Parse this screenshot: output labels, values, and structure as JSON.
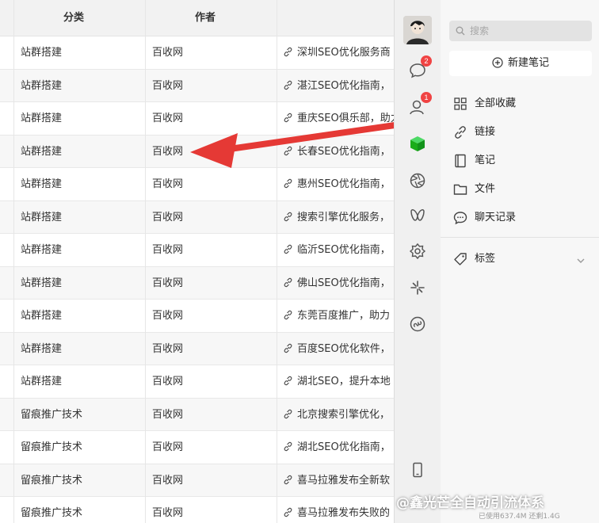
{
  "table": {
    "headers": {
      "category": "分类",
      "author": "作者"
    },
    "rows": [
      {
        "category": "站群搭建",
        "author": "百收网",
        "link": "深圳SEO优化服务商"
      },
      {
        "category": "站群搭建",
        "author": "百收网",
        "link": "湛江SEO优化指南，"
      },
      {
        "category": "站群搭建",
        "author": "百收网",
        "link": "重庆SEO俱乐部，助力"
      },
      {
        "category": "站群搭建",
        "author": "百收网",
        "link": "长春SEO优化指南，"
      },
      {
        "category": "站群搭建",
        "author": "百收网",
        "link": "惠州SEO优化指南，"
      },
      {
        "category": "站群搭建",
        "author": "百收网",
        "link": "搜索引擎优化服务，"
      },
      {
        "category": "站群搭建",
        "author": "百收网",
        "link": "临沂SEO优化指南，"
      },
      {
        "category": "站群搭建",
        "author": "百收网",
        "link": "佛山SEO优化指南，"
      },
      {
        "category": "站群搭建",
        "author": "百收网",
        "link": "东莞百度推广，助力"
      },
      {
        "category": "站群搭建",
        "author": "百收网",
        "link": "百度SEO优化软件，"
      },
      {
        "category": "站群搭建",
        "author": "百收网",
        "link": "湖北SEO，提升本地"
      },
      {
        "category": "留痕推广技术",
        "author": "百收网",
        "link": "北京搜索引擎优化，"
      },
      {
        "category": "留痕推广技术",
        "author": "百收网",
        "link": "湖北SEO优化指南，"
      },
      {
        "category": "留痕推广技术",
        "author": "百收网",
        "link": "喜马拉雅发布全新软"
      },
      {
        "category": "留痕推广技术",
        "author": "百收网",
        "link": "喜马拉雅发布失败的"
      }
    ]
  },
  "rail": {
    "icons": [
      "avatar",
      "chat-icon",
      "contacts-icon",
      "cube-icon",
      "aperture-icon",
      "butterfly-icon",
      "gear-flower-icon",
      "sparkle-icon",
      "mini-program-icon",
      "phone-icon"
    ],
    "chat_badge": "2",
    "contacts_badge": "1"
  },
  "panel": {
    "search_placeholder": "搜索",
    "new_note": "新建笔记",
    "nav": {
      "all": "全部收藏",
      "links": "链接",
      "notes": "笔记",
      "files": "文件",
      "chat_records": "聊天记录",
      "tags": "标签"
    },
    "storage": "已使用637.4M 还剩1.4G",
    "watermark": "@鑫光芒全自动引流体系"
  },
  "colors": {
    "accent_green": "#1aad19",
    "badge_red": "#f04343",
    "arrow_red": "#e53935"
  }
}
